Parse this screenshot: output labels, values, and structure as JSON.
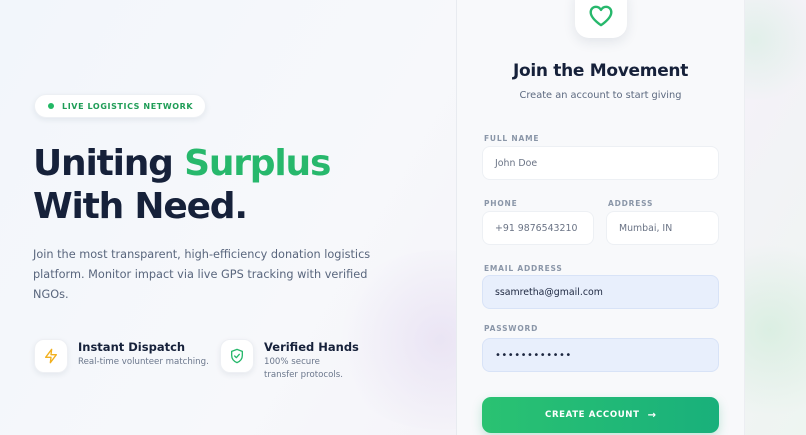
{
  "badge": {
    "label": "LIVE LOGISTICS NETWORK"
  },
  "hero": {
    "title_line1_part1": "Uniting ",
    "title_line1_accent": "Surplus",
    "title_line2": "With Need.",
    "description": "Join the most transparent, high-efficiency donation logistics platform. Monitor impact via live GPS tracking with verified NGOs."
  },
  "features": [
    {
      "title": "Instant Dispatch",
      "subtitle": "Real-time volunteer matching.",
      "icon": "lightning-icon"
    },
    {
      "title": "Verified Hands",
      "subtitle": "100% secure transfer protocols.",
      "icon": "shield-check-icon"
    }
  ],
  "form": {
    "logo_icon": "heart-icon",
    "title": "Join the Movement",
    "subtitle": "Create an account to start giving",
    "full_name": {
      "label": "FULL NAME",
      "placeholder": "John Doe"
    },
    "phone": {
      "label": "PHONE",
      "placeholder": "+91 9876543210"
    },
    "address": {
      "label": "ADDRESS",
      "placeholder": "Mumbai, IN"
    },
    "email": {
      "label": "EMAIL ADDRESS",
      "value": "ssamretha@gmail.com"
    },
    "password": {
      "label": "PASSWORD",
      "value": "••••••••••••"
    },
    "submit_label": "CREATE ACCOUNT",
    "submit_arrow": "→"
  },
  "colors": {
    "accent": "#27b86c",
    "heading": "#16213a",
    "button_start": "#2ac272",
    "button_end": "#19b07b"
  }
}
